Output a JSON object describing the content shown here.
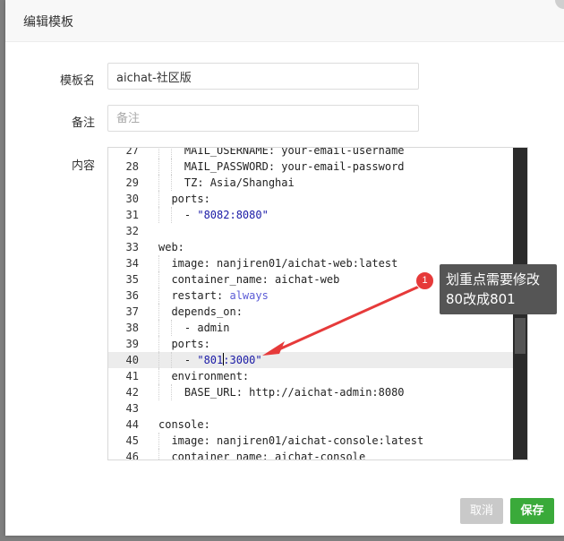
{
  "dialog": {
    "title": "编辑模板"
  },
  "form": {
    "name_label": "模板名",
    "name_value": "aichat-社区版",
    "remark_label": "备注",
    "remark_placeholder": "备注",
    "content_label": "内容"
  },
  "editor": {
    "lines": [
      {
        "num": "27",
        "text": "    MAIL_USERNAME: your-email-username"
      },
      {
        "num": "28",
        "text": "    MAIL_PASSWORD: your-email-password"
      },
      {
        "num": "29",
        "text": "    TZ: Asia/Shanghai"
      },
      {
        "num": "30",
        "text": "  ports:"
      },
      {
        "num": "31",
        "text": "    - \"8082:8080\""
      },
      {
        "num": "32",
        "text": ""
      },
      {
        "num": "33",
        "text": "web:"
      },
      {
        "num": "34",
        "text": "  image: nanjiren01/aichat-web:latest"
      },
      {
        "num": "35",
        "text": "  container_name: aichat-web"
      },
      {
        "num": "36",
        "text": "  restart: always"
      },
      {
        "num": "37",
        "text": "  depends_on:"
      },
      {
        "num": "38",
        "text": "    - admin"
      },
      {
        "num": "39",
        "text": "  ports:"
      },
      {
        "num": "40",
        "text": "    - \"801:3000\""
      },
      {
        "num": "41",
        "text": "  environment:"
      },
      {
        "num": "42",
        "text": "    BASE_URL: http://aichat-admin:8080"
      },
      {
        "num": "43",
        "text": ""
      },
      {
        "num": "44",
        "text": "console:"
      },
      {
        "num": "45",
        "text": "  image: nanjiren01/aichat-console:latest"
      },
      {
        "num": "46",
        "text": "  container_name: aichat-console"
      }
    ],
    "active_line": "40"
  },
  "annotation": {
    "badge": "1",
    "line1": "划重点需要修改",
    "line2": "80改成801",
    "color": "#e63a3a"
  },
  "buttons": {
    "cancel": "取消",
    "save": "保存"
  }
}
